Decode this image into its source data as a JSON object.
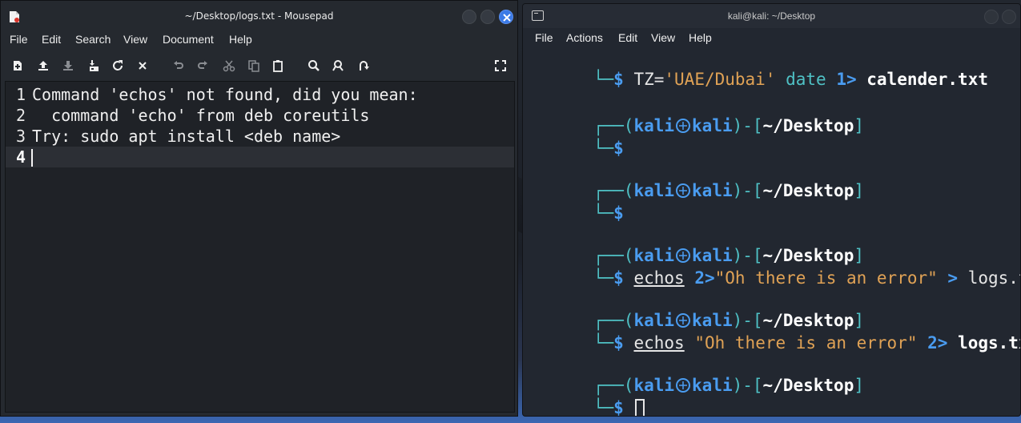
{
  "mousepad": {
    "title": "~/Desktop/logs.txt - Mousepad",
    "menu": [
      "File",
      "Edit",
      "Search",
      "View",
      "Document",
      "Help"
    ],
    "toolbar_icons": [
      "new-file-icon",
      "save-icon",
      "save-as-icon",
      "print-icon",
      "reload-icon",
      "close-icon",
      "undo-icon",
      "redo-icon",
      "cut-icon",
      "copy-icon",
      "paste-icon",
      "find-icon",
      "replace-icon",
      "goto-icon",
      "fullscreen-icon"
    ],
    "lines": [
      {
        "num": "1",
        "text": "Command 'echos' not found, did you mean:"
      },
      {
        "num": "2",
        "text": "  command 'echo' from deb coreutils"
      },
      {
        "num": "3",
        "text": "Try: sudo apt install <deb name>"
      },
      {
        "num": "4",
        "text": ""
      }
    ]
  },
  "terminal": {
    "title": "kali@kali: ~/Desktop",
    "menu": [
      "File",
      "Actions",
      "Edit",
      "View",
      "Help"
    ],
    "line0": {
      "dollar": "$",
      "p1": " TZ=",
      "p2": "'UAE/Dubai'",
      "p3": " date ",
      "p4": "1>",
      "p5": " calender.txt"
    },
    "prompt": {
      "user": "kali",
      "host": "kali",
      "sep": ")-[",
      "path": "~/Desktop",
      "close": "]",
      "open": "(",
      "dollar": "$"
    },
    "cmd3": {
      "cmd": "echos",
      "redir": " 2>",
      "str": "\"Oh there is an error\"",
      "gt": " >",
      "file": " logs.txt"
    },
    "cmd4": {
      "cmd": "echos",
      "str": " \"Oh there is an error\"",
      "redir": " 2>",
      "file": " logs.txt"
    }
  }
}
